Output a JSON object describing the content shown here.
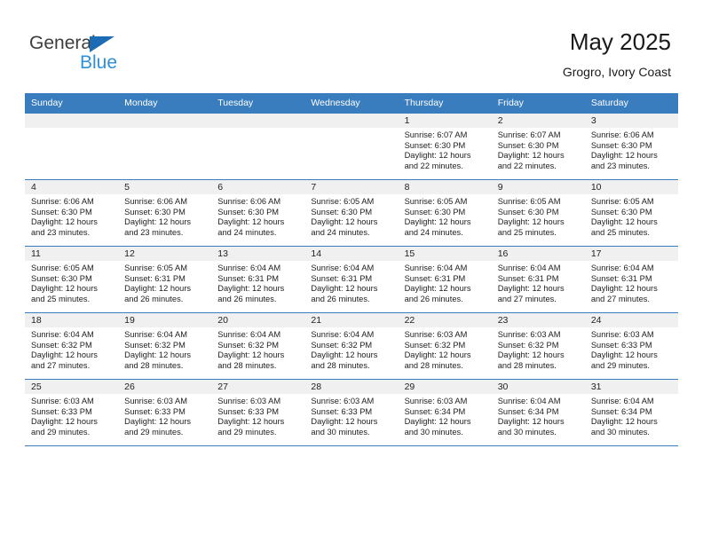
{
  "brand": {
    "word_general": "General",
    "word_blue": "Blue",
    "flag_color": "#1b6cb5",
    "blue_color": "#2f8fd8"
  },
  "header": {
    "title": "May 2025",
    "subtitle": "Grogro, Ivory Coast",
    "header_bg_color": "#3a7dbe",
    "daynum_bg_color": "#f0f0f0"
  },
  "weekday_headers": [
    "Sunday",
    "Monday",
    "Tuesday",
    "Wednesday",
    "Thursday",
    "Friday",
    "Saturday"
  ],
  "weeks": [
    [
      {
        "day": "",
        "empty": true
      },
      {
        "day": "",
        "empty": true
      },
      {
        "day": "",
        "empty": true
      },
      {
        "day": "",
        "empty": true
      },
      {
        "day": "1",
        "sunrise": "Sunrise: 6:07 AM",
        "sunset": "Sunset: 6:30 PM",
        "daylight_1": "Daylight: 12 hours",
        "daylight_2": "and 22 minutes."
      },
      {
        "day": "2",
        "sunrise": "Sunrise: 6:07 AM",
        "sunset": "Sunset: 6:30 PM",
        "daylight_1": "Daylight: 12 hours",
        "daylight_2": "and 22 minutes."
      },
      {
        "day": "3",
        "sunrise": "Sunrise: 6:06 AM",
        "sunset": "Sunset: 6:30 PM",
        "daylight_1": "Daylight: 12 hours",
        "daylight_2": "and 23 minutes."
      }
    ],
    [
      {
        "day": "4",
        "sunrise": "Sunrise: 6:06 AM",
        "sunset": "Sunset: 6:30 PM",
        "daylight_1": "Daylight: 12 hours",
        "daylight_2": "and 23 minutes."
      },
      {
        "day": "5",
        "sunrise": "Sunrise: 6:06 AM",
        "sunset": "Sunset: 6:30 PM",
        "daylight_1": "Daylight: 12 hours",
        "daylight_2": "and 23 minutes."
      },
      {
        "day": "6",
        "sunrise": "Sunrise: 6:06 AM",
        "sunset": "Sunset: 6:30 PM",
        "daylight_1": "Daylight: 12 hours",
        "daylight_2": "and 24 minutes."
      },
      {
        "day": "7",
        "sunrise": "Sunrise: 6:05 AM",
        "sunset": "Sunset: 6:30 PM",
        "daylight_1": "Daylight: 12 hours",
        "daylight_2": "and 24 minutes."
      },
      {
        "day": "8",
        "sunrise": "Sunrise: 6:05 AM",
        "sunset": "Sunset: 6:30 PM",
        "daylight_1": "Daylight: 12 hours",
        "daylight_2": "and 24 minutes."
      },
      {
        "day": "9",
        "sunrise": "Sunrise: 6:05 AM",
        "sunset": "Sunset: 6:30 PM",
        "daylight_1": "Daylight: 12 hours",
        "daylight_2": "and 25 minutes."
      },
      {
        "day": "10",
        "sunrise": "Sunrise: 6:05 AM",
        "sunset": "Sunset: 6:30 PM",
        "daylight_1": "Daylight: 12 hours",
        "daylight_2": "and 25 minutes."
      }
    ],
    [
      {
        "day": "11",
        "sunrise": "Sunrise: 6:05 AM",
        "sunset": "Sunset: 6:30 PM",
        "daylight_1": "Daylight: 12 hours",
        "daylight_2": "and 25 minutes."
      },
      {
        "day": "12",
        "sunrise": "Sunrise: 6:05 AM",
        "sunset": "Sunset: 6:31 PM",
        "daylight_1": "Daylight: 12 hours",
        "daylight_2": "and 26 minutes."
      },
      {
        "day": "13",
        "sunrise": "Sunrise: 6:04 AM",
        "sunset": "Sunset: 6:31 PM",
        "daylight_1": "Daylight: 12 hours",
        "daylight_2": "and 26 minutes."
      },
      {
        "day": "14",
        "sunrise": "Sunrise: 6:04 AM",
        "sunset": "Sunset: 6:31 PM",
        "daylight_1": "Daylight: 12 hours",
        "daylight_2": "and 26 minutes."
      },
      {
        "day": "15",
        "sunrise": "Sunrise: 6:04 AM",
        "sunset": "Sunset: 6:31 PM",
        "daylight_1": "Daylight: 12 hours",
        "daylight_2": "and 26 minutes."
      },
      {
        "day": "16",
        "sunrise": "Sunrise: 6:04 AM",
        "sunset": "Sunset: 6:31 PM",
        "daylight_1": "Daylight: 12 hours",
        "daylight_2": "and 27 minutes."
      },
      {
        "day": "17",
        "sunrise": "Sunrise: 6:04 AM",
        "sunset": "Sunset: 6:31 PM",
        "daylight_1": "Daylight: 12 hours",
        "daylight_2": "and 27 minutes."
      }
    ],
    [
      {
        "day": "18",
        "sunrise": "Sunrise: 6:04 AM",
        "sunset": "Sunset: 6:32 PM",
        "daylight_1": "Daylight: 12 hours",
        "daylight_2": "and 27 minutes."
      },
      {
        "day": "19",
        "sunrise": "Sunrise: 6:04 AM",
        "sunset": "Sunset: 6:32 PM",
        "daylight_1": "Daylight: 12 hours",
        "daylight_2": "and 28 minutes."
      },
      {
        "day": "20",
        "sunrise": "Sunrise: 6:04 AM",
        "sunset": "Sunset: 6:32 PM",
        "daylight_1": "Daylight: 12 hours",
        "daylight_2": "and 28 minutes."
      },
      {
        "day": "21",
        "sunrise": "Sunrise: 6:04 AM",
        "sunset": "Sunset: 6:32 PM",
        "daylight_1": "Daylight: 12 hours",
        "daylight_2": "and 28 minutes."
      },
      {
        "day": "22",
        "sunrise": "Sunrise: 6:03 AM",
        "sunset": "Sunset: 6:32 PM",
        "daylight_1": "Daylight: 12 hours",
        "daylight_2": "and 28 minutes."
      },
      {
        "day": "23",
        "sunrise": "Sunrise: 6:03 AM",
        "sunset": "Sunset: 6:32 PM",
        "daylight_1": "Daylight: 12 hours",
        "daylight_2": "and 28 minutes."
      },
      {
        "day": "24",
        "sunrise": "Sunrise: 6:03 AM",
        "sunset": "Sunset: 6:33 PM",
        "daylight_1": "Daylight: 12 hours",
        "daylight_2": "and 29 minutes."
      }
    ],
    [
      {
        "day": "25",
        "sunrise": "Sunrise: 6:03 AM",
        "sunset": "Sunset: 6:33 PM",
        "daylight_1": "Daylight: 12 hours",
        "daylight_2": "and 29 minutes."
      },
      {
        "day": "26",
        "sunrise": "Sunrise: 6:03 AM",
        "sunset": "Sunset: 6:33 PM",
        "daylight_1": "Daylight: 12 hours",
        "daylight_2": "and 29 minutes."
      },
      {
        "day": "27",
        "sunrise": "Sunrise: 6:03 AM",
        "sunset": "Sunset: 6:33 PM",
        "daylight_1": "Daylight: 12 hours",
        "daylight_2": "and 29 minutes."
      },
      {
        "day": "28",
        "sunrise": "Sunrise: 6:03 AM",
        "sunset": "Sunset: 6:33 PM",
        "daylight_1": "Daylight: 12 hours",
        "daylight_2": "and 30 minutes."
      },
      {
        "day": "29",
        "sunrise": "Sunrise: 6:03 AM",
        "sunset": "Sunset: 6:34 PM",
        "daylight_1": "Daylight: 12 hours",
        "daylight_2": "and 30 minutes."
      },
      {
        "day": "30",
        "sunrise": "Sunrise: 6:04 AM",
        "sunset": "Sunset: 6:34 PM",
        "daylight_1": "Daylight: 12 hours",
        "daylight_2": "and 30 minutes."
      },
      {
        "day": "31",
        "sunrise": "Sunrise: 6:04 AM",
        "sunset": "Sunset: 6:34 PM",
        "daylight_1": "Daylight: 12 hours",
        "daylight_2": "and 30 minutes."
      }
    ]
  ]
}
